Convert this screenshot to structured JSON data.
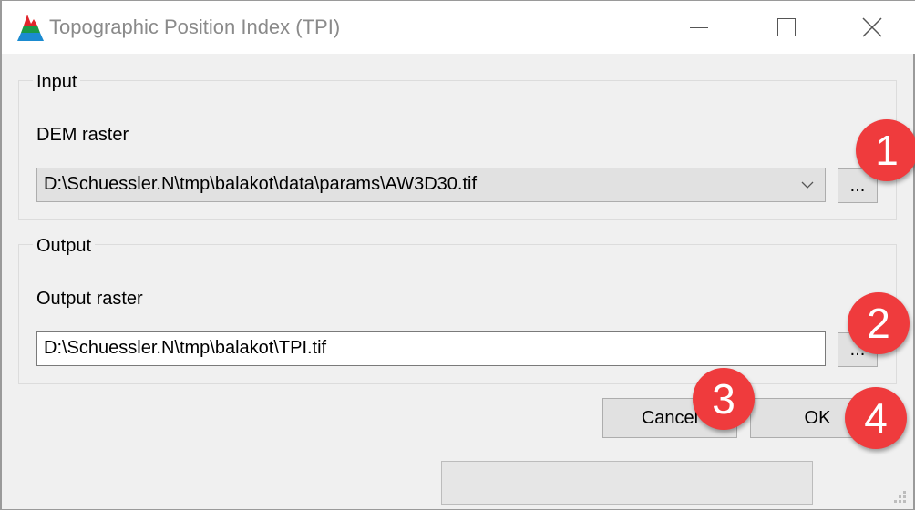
{
  "window": {
    "title": "Topographic Position Index (TPI)",
    "app_icon": "mountain-icon",
    "controls": [
      "minimize-icon",
      "maximize-icon",
      "close-icon"
    ]
  },
  "input_group": {
    "legend": "Input",
    "dem_label": "DEM raster",
    "dem_value": "D:\\Schuessler.N\\tmp\\balakot\\data\\params\\AW3D30.tif",
    "browse_label": "..."
  },
  "output_group": {
    "legend": "Output",
    "output_label": "Output raster",
    "output_value": "D:\\Schuessler.N\\tmp\\balakot\\TPI.tif",
    "browse_label": "..."
  },
  "buttons": {
    "cancel": "Cancel",
    "ok": "OK"
  },
  "progress": {
    "value": 0
  },
  "annotations": {
    "badge1": "1",
    "badge2": "2",
    "badge3": "3",
    "badge4": "4",
    "color": "#ef3b3d"
  }
}
